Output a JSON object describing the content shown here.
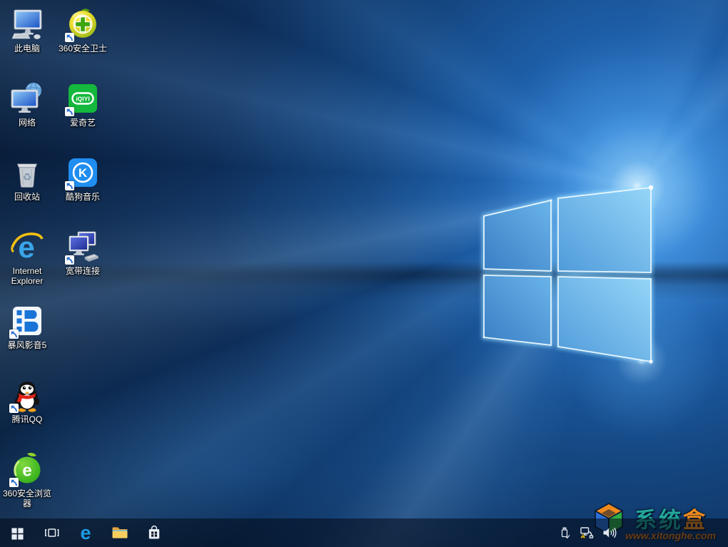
{
  "desktop": {
    "icons": [
      {
        "label": "此电脑",
        "icon": "this-pc-icon",
        "shortcut": false
      },
      {
        "label": "360安全卫士",
        "icon": "360-safety-guard-icon",
        "shortcut": true
      },
      {
        "label": "网络",
        "icon": "network-icon",
        "shortcut": false
      },
      {
        "label": "爱奇艺",
        "icon": "iqiyi-icon",
        "shortcut": true,
        "logo_text": "iQIYI"
      },
      {
        "label": "回收站",
        "icon": "recycle-bin-icon",
        "shortcut": false
      },
      {
        "label": "酷狗音乐",
        "icon": "kugou-music-icon",
        "shortcut": true,
        "logo_text": "K"
      },
      {
        "label": "Internet Explorer",
        "icon": "internet-explorer-icon",
        "shortcut": false,
        "logo_text": "e"
      },
      {
        "label": "宽带连接",
        "icon": "broadband-connection-icon",
        "shortcut": true
      },
      {
        "label": "暴风影音5",
        "icon": "baofeng-player-icon",
        "shortcut": true
      },
      {
        "label": "腾讯QQ",
        "icon": "tencent-qq-icon",
        "shortcut": true
      },
      {
        "label": "360安全浏览器",
        "icon": "360-safe-browser-icon",
        "shortcut": true,
        "logo_text": "e"
      }
    ]
  },
  "taskbar": {
    "buttons": [
      "start",
      "task-view",
      "edge",
      "file-explorer",
      "store"
    ],
    "tray": [
      "usb-device",
      "network-warning",
      "volume"
    ]
  },
  "watermark": {
    "brand_part1": "系统",
    "brand_part2": "盒",
    "url": "www.xitonghe.com",
    "teal": "#23a79b",
    "orange": "#f08a1e"
  }
}
